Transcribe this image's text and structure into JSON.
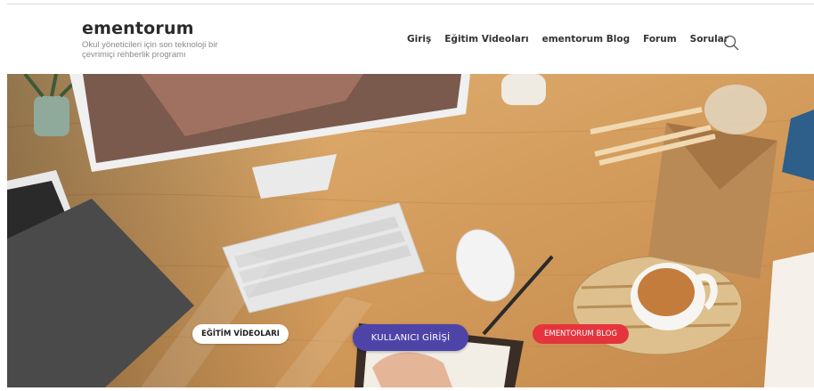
{
  "site": {
    "name": "ementorum",
    "tagline": "Okul yöneticileri için son teknoloji bir çevrimiçi rehberlik programı"
  },
  "nav": {
    "items": [
      {
        "label": "Giriş"
      },
      {
        "label": "Eğitim Videoları"
      },
      {
        "label": "ementorum Blog"
      },
      {
        "label": "Forum"
      },
      {
        "label": "Sorular"
      }
    ],
    "search_icon": "search-icon"
  },
  "hero": {
    "buttons": {
      "videos": "EĞİTİM VİDEOLARI",
      "login": "KULLANICI GİRİŞİ",
      "blog": "EMENTORUM BLOG"
    }
  },
  "colors": {
    "login_button": "#4e44a8",
    "blog_button": "#e5343d",
    "videos_button": "#ffffff"
  }
}
